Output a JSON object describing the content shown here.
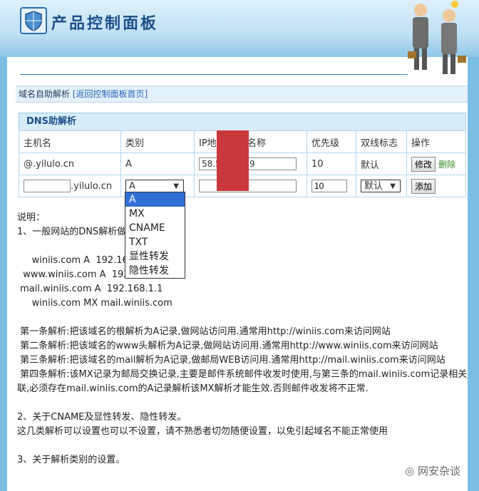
{
  "header": {
    "title": "产品控制面板"
  },
  "breadcrumb": {
    "label": "域名自助解析",
    "link": "[返回控制面板首页]"
  },
  "dns_table": {
    "caption": "DNS助解析",
    "columns": [
      "主机名",
      "类别",
      "IP地址/主机名称",
      "优先级",
      "双线标志",
      "操作"
    ],
    "row1": {
      "host": "@.yilulo.cn",
      "type": "A",
      "ip": "58.5",
      "ip_tail": "9",
      "priority": "10",
      "line": "默认",
      "edit": "修改",
      "delete": "删除"
    },
    "row2": {
      "host_suffix": ".yilulo.cn",
      "type": "A",
      "priority": "10",
      "line": "默认",
      "add": "添加"
    }
  },
  "dropdown": {
    "options": [
      "A",
      "MX",
      "CNAME",
      "TXT",
      "显性转发",
      "隐性转发"
    ],
    "selected": "A"
  },
  "content": {
    "l1": "说明：",
    "l2": "1、一般网站的DNS解析做",
    "l3": "     winiis.com A  192.168",
    "l4": "  www.winiis.com A  192.168.1.1",
    "l5": " mail.winiis.com A  192.168.1.1",
    "l6": "     winiis.com MX mail.winiis.com",
    "l7": " 第一条解析:把该域名的根解析为A记录,做网站访问用.通常用http://winiis.com来访问网站",
    "l8": " 第二条解析:把该域名的www头解析为A记录,做网站访问用.通常用http://www.winiis.com来访问网站",
    "l9": " 第三条解析:把该域名的mail解析为A记录,做邮局WEB访问用.通常用http://mail.winiis.com来访问网站",
    "l10": " 第四条解析:该MX记录为邮局交换记录,主要是邮件系统邮件收发时使用,与第三条的mail.winiis.com记录相关",
    "l11": "联,必须存在mail.winiis.com的A记录解析该MX解析才能生效.否则邮件收发将不正常.",
    "l12": "2、关于CNAME及显性转发、隐性转发。",
    "l13": "这几类解析可以设置也可以不设置，请不熟悉者切勿随便设置，以免引起域名不能正常使用",
    "l14": "3、关于解析类别的设置。"
  },
  "watermark": "网安杂谈"
}
